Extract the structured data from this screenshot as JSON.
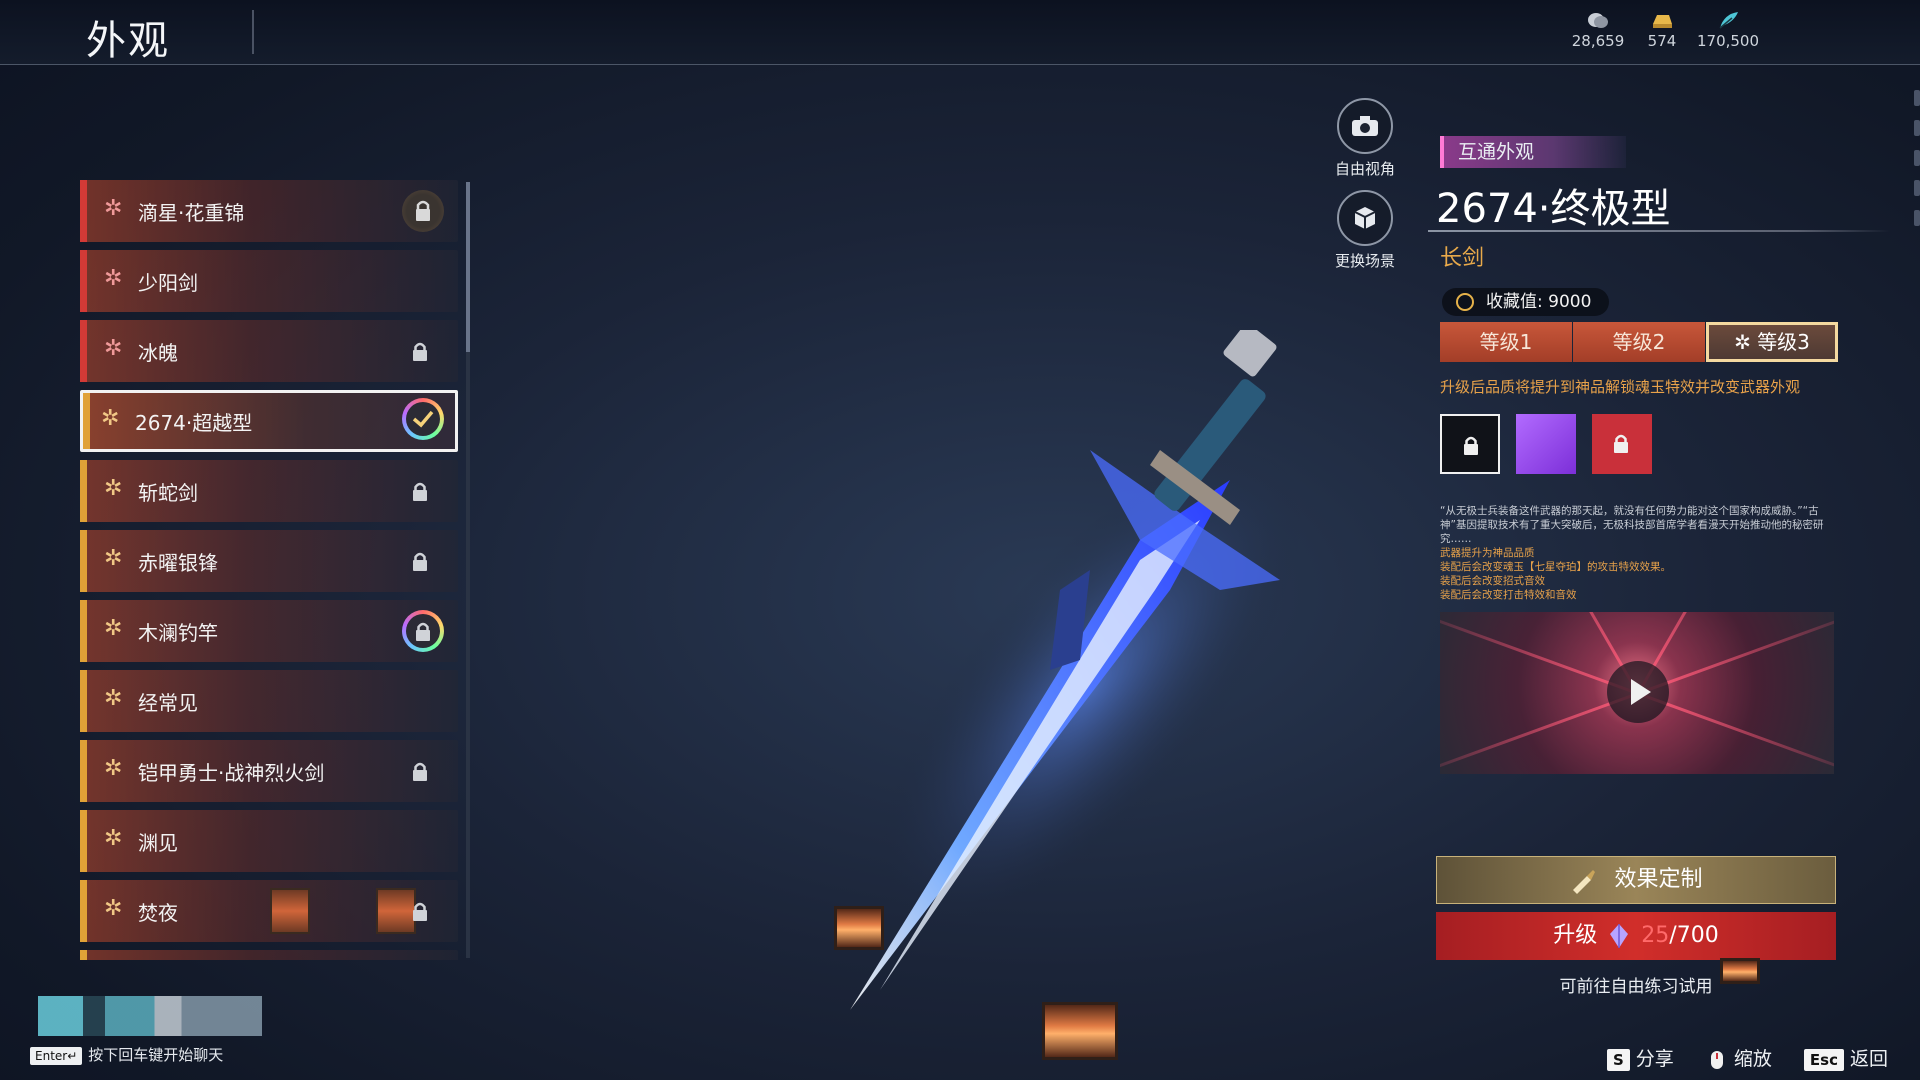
{
  "header": {
    "title": "外观",
    "currencies": [
      {
        "icon": "coin-stack-icon",
        "value": "28,659"
      },
      {
        "icon": "gold-ingot-icon",
        "value": "574"
      },
      {
        "icon": "feather-icon",
        "value": "170,500"
      }
    ]
  },
  "weapon_list": [
    {
      "name": "滴星·花重锦",
      "tier": "red",
      "status": "locked-circled"
    },
    {
      "name": "少阳剑",
      "tier": "red",
      "status": "none"
    },
    {
      "name": "冰魄",
      "tier": "red",
      "status": "locked"
    },
    {
      "name": "2674·超越型",
      "tier": "gold",
      "status": "equipped"
    },
    {
      "name": "斩蛇剑",
      "tier": "gold",
      "status": "locked"
    },
    {
      "name": "赤曜银锋",
      "tier": "gold",
      "status": "locked"
    },
    {
      "name": "木澜钓竿",
      "tier": "gold",
      "status": "locked-rainbow"
    },
    {
      "name": "经常见",
      "tier": "gold",
      "status": "none"
    },
    {
      "name": "铠甲勇士·战神烈火剑",
      "tier": "gold",
      "status": "locked"
    },
    {
      "name": "渊见",
      "tier": "gold",
      "status": "none"
    },
    {
      "name": "焚夜",
      "tier": "gold",
      "status": "locked"
    }
  ],
  "camera_controls": {
    "free_view": "自由视角",
    "change_scene": "更换场景"
  },
  "detail": {
    "tag": "互通外观",
    "title": "2674·终极型",
    "weapon_type": "长剑",
    "collection_label": "收藏值: 9000",
    "levels": [
      "等级1",
      "等级2",
      "等级3"
    ],
    "active_level": "等级3",
    "upgrade_note": "升级后品质将提升到神品解锁魂玉特效并改变武器外观",
    "swatches": [
      {
        "color": "#101218",
        "locked": true
      },
      {
        "color": "#9a4cf0",
        "locked": false
      },
      {
        "color": "#c9303a",
        "locked": true
      }
    ],
    "lore": "“从无极士兵装备这件武器的那天起，就没有任何势力能对这个国家构成威胁。”“古神”基因提取技术有了重大突破后，无极科技部首席学者看漫天开始推动他的秘密研究……",
    "effects": [
      "武器提升为神品品质",
      "装配后会改变魂玉【七星夺珀】的攻击特效效果。",
      "装配后会改变招式音效",
      "装配后会改变打击特效和音效"
    ],
    "effect_custom_button": "效果定制",
    "upgrade_button_label": "升级",
    "upgrade_current": "25",
    "upgrade_total": "/700",
    "trial_hint": "可前往自由练习试用"
  },
  "footer": {
    "enter_key": "Enter↵",
    "chat_hint": "按下回车键开始聊天",
    "share_key": "S",
    "share_label": "分享",
    "zoom_label": "缩放",
    "back_key": "Esc",
    "back_label": "返回"
  },
  "colors": {
    "red_tier": "#d23a36",
    "gold_tier": "#e0a137",
    "accent_orange": "#e8a94a",
    "upgrade_red": "#d12e2a"
  }
}
